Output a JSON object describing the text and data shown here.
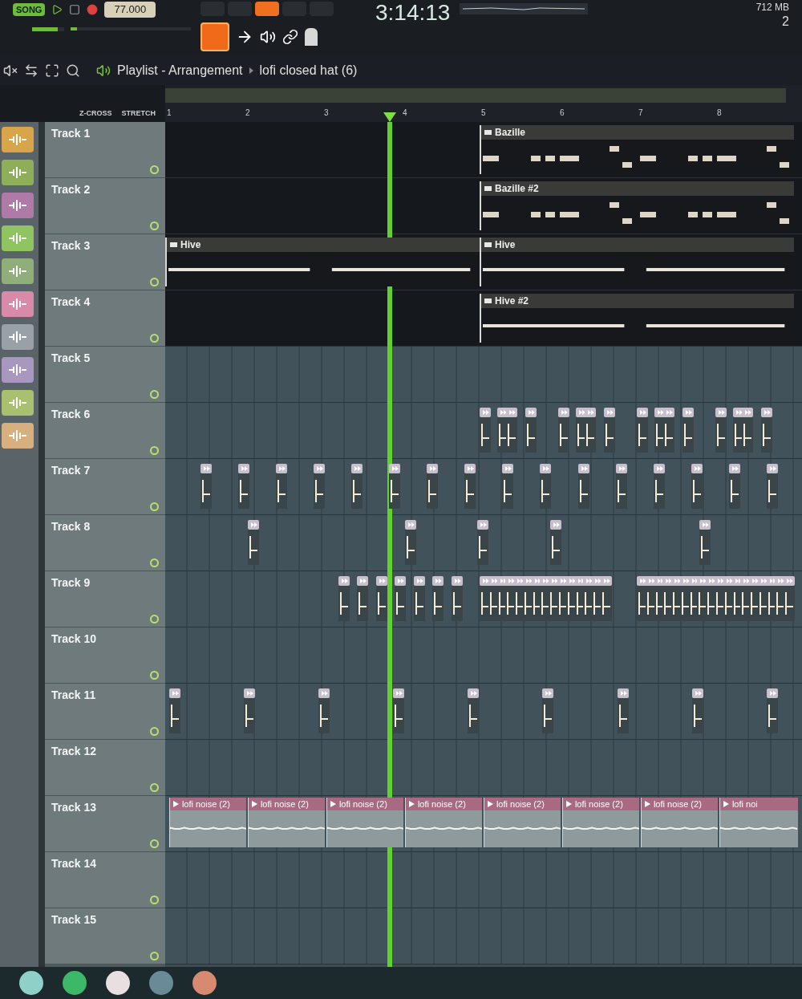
{
  "transport": {
    "mode": "SONG",
    "tempo": "77.000",
    "time": "3:14:13",
    "memory": "712 MB",
    "cpu": "2",
    "volume": {
      "level": 0.8
    },
    "pitch": {
      "level": 0.05
    }
  },
  "breadcrumb": {
    "title": "Playlist - Arrangement",
    "pattern": "lofi closed hat (6)"
  },
  "ruler": {
    "options": [
      "Z-CROSS",
      "STRETCH"
    ],
    "bars": [
      "1",
      "2",
      "3",
      "4",
      "5",
      "6",
      "7",
      "8"
    ]
  },
  "channels": [
    {
      "color": "#d9a54a"
    },
    {
      "color": "#8fae5a"
    },
    {
      "color": "#b07aa8"
    },
    {
      "color": "#8fc460"
    },
    {
      "color": "#8fae7a"
    },
    {
      "color": "#d98aa8"
    },
    {
      "color": "#9aa0a8"
    },
    {
      "color": "#a898c0"
    },
    {
      "color": "#a8c070"
    },
    {
      "color": "#d8b080"
    }
  ],
  "tracks": [
    {
      "name": "Track 1",
      "clips": [
        {
          "label": "Bazille",
          "kind": "synth"
        }
      ]
    },
    {
      "name": "Track 2",
      "clips": [
        {
          "label": "Bazille #2",
          "kind": "synth"
        }
      ]
    },
    {
      "name": "Track 3",
      "clips": [
        {
          "label": "Hive",
          "kind": "pad"
        },
        {
          "label": "Hive",
          "kind": "pad"
        }
      ]
    },
    {
      "name": "Track 4",
      "clips": [
        {
          "label": "Hive #2",
          "kind": "pad"
        }
      ]
    },
    {
      "name": "Track 5"
    },
    {
      "name": "Track 6"
    },
    {
      "name": "Track 7"
    },
    {
      "name": "Track 8"
    },
    {
      "name": "Track 9"
    },
    {
      "name": "Track 10"
    },
    {
      "name": "Track 11"
    },
    {
      "name": "Track 12"
    },
    {
      "name": "Track 13",
      "clips": [
        {
          "label": "lofi noise (2)",
          "kind": "audio"
        },
        {
          "label": "lofi noise (2)",
          "kind": "audio"
        },
        {
          "label": "lofi noise (2)",
          "kind": "audio"
        },
        {
          "label": "lofi noise (2)",
          "kind": "audio"
        },
        {
          "label": "lofi noise (2)",
          "kind": "audio"
        },
        {
          "label": "lofi noise (2)",
          "kind": "audio"
        },
        {
          "label": "lofi noise (2)",
          "kind": "audio"
        },
        {
          "label": "lofi noi",
          "kind": "audio"
        }
      ]
    },
    {
      "name": "Track 14"
    },
    {
      "name": "Track 15"
    }
  ]
}
